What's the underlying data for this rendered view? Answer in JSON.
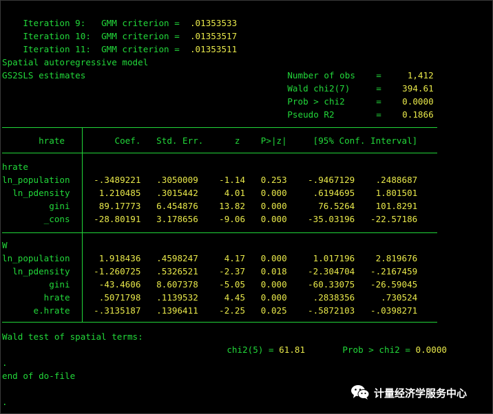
{
  "colors": {
    "label": "#22d83a",
    "value": "#e8e84a",
    "background": "#000000"
  },
  "iterations": [
    {
      "label": "Iteration 9:   GMM criterion = ",
      "value": " .01353533"
    },
    {
      "label": "Iteration 10:  GMM criterion = ",
      "value": " .01353517"
    },
    {
      "label": "Iteration 11:  GMM criterion = ",
      "value": " .01353511"
    }
  ],
  "model": {
    "title": "Spatial autoregressive model",
    "method": "GS2SLS estimates",
    "stats": [
      {
        "label": "Number of obs    =",
        "value": "     1,412"
      },
      {
        "label": "Wald chi2(7)     =",
        "value": "    394.61"
      },
      {
        "label": "Prob > chi2      =",
        "value": "    0.0000"
      },
      {
        "label": "Pseudo R2        =",
        "value": "    0.1866"
      }
    ]
  },
  "table": {
    "depvar_header": "       hrate ",
    "header": "      Coef.   Std. Err.      z    P>|z|     [95% Conf. Interval]",
    "sections": [
      {
        "name": "hrate",
        "rows": [
          {
            "label": "ln_population ",
            "values": "  -.3489221   .3050009    -1.14   0.253    -.9467129    .2488687"
          },
          {
            "label": "  ln_pdensity ",
            "values": "   1.210485   .3015442     4.01   0.000     .6194695    1.801501"
          },
          {
            "label": "         gini ",
            "values": "   89.17773   6.454876    13.82   0.000      76.5264    101.8291"
          },
          {
            "label": "        _cons ",
            "values": "  -28.80191   3.178656    -9.06   0.000    -35.03196   -22.57186"
          }
        ]
      },
      {
        "name": "W",
        "rows": [
          {
            "label": "ln_population ",
            "values": "   1.918436   .4598247     4.17   0.000     1.017196    2.819676"
          },
          {
            "label": "  ln_pdensity ",
            "values": "  -1.260725   .5326521    -2.37   0.018    -2.304704   -.2167459"
          },
          {
            "label": "         gini ",
            "values": "   -43.4606   8.607378    -5.05   0.000    -60.33075   -26.59045"
          },
          {
            "label": "        hrate ",
            "values": "   .5071798   .1139532     4.45   0.000     .2838356     .730524"
          },
          {
            "label": "      e.hrate ",
            "values": "  -.3135187   .1396411    -2.25   0.025    -.5872103   -.0398271"
          }
        ]
      }
    ]
  },
  "wald_test": {
    "label": "Wald test of spatial terms:",
    "chi2_label": "chi2(5) = ",
    "chi2_value": "61.81",
    "prob_label": "Prob > chi2 = ",
    "prob_value": "0.0000"
  },
  "footer": {
    "dot1": ".",
    "end_line": "end of do-file",
    "dot2": "."
  },
  "watermark": {
    "icon": "wechat-icon",
    "text": "计量经济学服务中心"
  }
}
